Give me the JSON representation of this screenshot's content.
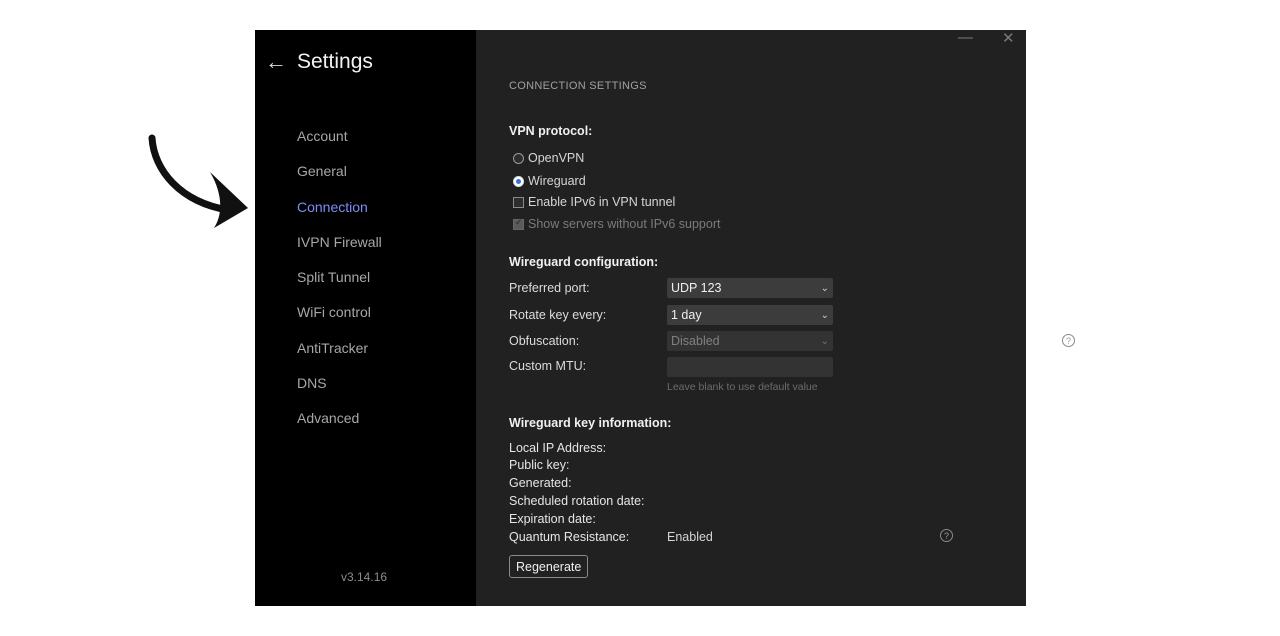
{
  "header": {
    "title": "Settings",
    "back_icon": "←"
  },
  "sidebar": {
    "items": [
      {
        "label": "Account",
        "active": false
      },
      {
        "label": "General",
        "active": false
      },
      {
        "label": "Connection",
        "active": true
      },
      {
        "label": "IVPN Firewall",
        "active": false
      },
      {
        "label": "Split Tunnel",
        "active": false
      },
      {
        "label": "WiFi control",
        "active": false
      },
      {
        "label": "AntiTracker",
        "active": false
      },
      {
        "label": "DNS",
        "active": false
      },
      {
        "label": "Advanced",
        "active": false
      }
    ],
    "version": "v3.14.16",
    "active_color": "#7d8cf8"
  },
  "window_controls": {
    "minimize": "—",
    "close": "✕"
  },
  "main": {
    "section_title": "CONNECTION SETTINGS",
    "vpn_protocol": {
      "label": "VPN protocol:",
      "options": [
        {
          "label": "OpenVPN",
          "checked": false
        },
        {
          "label": "Wireguard",
          "checked": true
        }
      ]
    },
    "checkboxes": {
      "ipv6": {
        "label": "Enable IPv6 in VPN tunnel",
        "checked": false
      },
      "show_servers": {
        "label": "Show servers without IPv6 support",
        "checked": true,
        "disabled": true
      }
    },
    "wireguard_config": {
      "label": "Wireguard configuration:",
      "preferred_port": {
        "label": "Preferred port:",
        "value": "UDP 123"
      },
      "rotate_key": {
        "label": "Rotate key every:",
        "value": "1 day"
      },
      "obfuscation": {
        "label": "Obfuscation:",
        "value": "Disabled"
      },
      "custom_mtu": {
        "label": "Custom MTU:",
        "value": "",
        "hint": "Leave blank to use default value"
      }
    },
    "key_info": {
      "label": "Wireguard key information:",
      "local_ip": "Local IP Address:",
      "public_key": "Public key:",
      "generated": "Generated:",
      "scheduled_rotation": "Scheduled rotation date:",
      "expiration": "Expiration date:",
      "quantum_label": "Quantum Resistance:",
      "quantum_value": "Enabled"
    },
    "regenerate_label": "Regenerate"
  }
}
